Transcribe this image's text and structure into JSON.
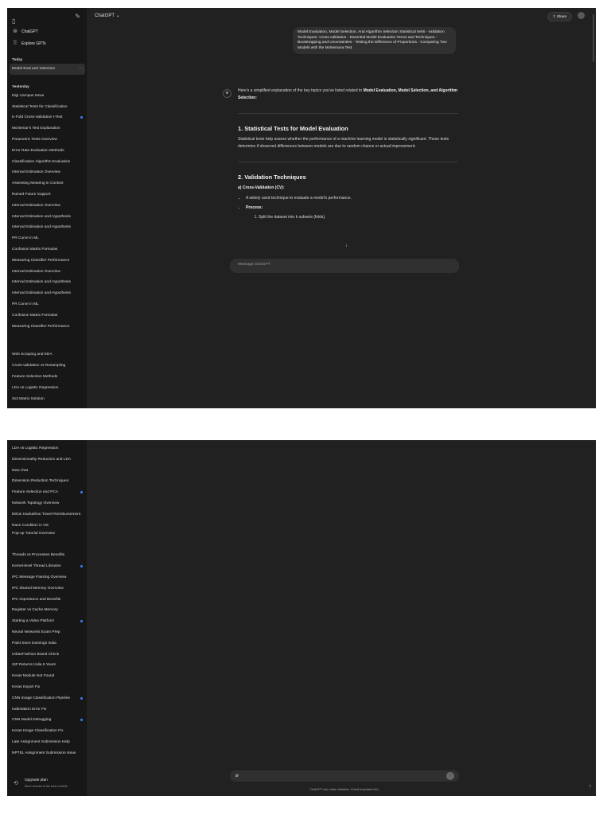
{
  "top": {
    "header": {
      "model": "ChatGPT ⌄",
      "share": "⇧ Share"
    },
    "sidebar": {
      "nav": [
        {
          "icon": "chatgpt-logo-icon",
          "label": "ChatGPT"
        },
        {
          "icon": "grid-icon",
          "label": "Explore GPTs"
        }
      ],
      "today_label": "Today",
      "today_items": [
        "Model Eval and Selection"
      ],
      "yesterday_label": "Yesterday",
      "yesterday_items": [
        "Digi Campus Issue",
        "Statistical Tests for Classification",
        "K-Fold Cross-Validation t-Test",
        "McNemar's Test Explanation",
        "Parametric Tests Overview",
        "Error Rate Evaluation Methods",
        "Classification Algorithm Evaluation",
        "Interval Estimation Overview",
        "Assessing Meaning in Context",
        "Ruined Future Support",
        "Interval Estimation Overview",
        "Interval Estimation and Hypothesis",
        "Interval Estimation and Hypothesis",
        "PR Curve in ML",
        "Confusion Matrix Formulas",
        "Measuring Classifier Performance",
        "Interval Estimation Overview",
        "Interval Estimation and Hypothesis",
        "Interval Estimation and Hypothesis",
        "PR Curve in ML",
        "Confusion Matrix Formulas",
        "Measuring Classifier Performance"
      ],
      "more_items": [
        "Web Scraping and EDA",
        "Cross-validation vs Resampling",
        "Feature Selection Methods",
        "LDA vs Logistic Regression",
        "3x3 Matrix Solution"
      ]
    },
    "user_message": "Model Evaluation, Model Selection, And Algorithm Selection Statistical tests - validation Techniques- Cross validation - Essential Model Evaluation Terms and Techniques - Bootstrapping and Uncertainties - Testing the Difference of Proportions - Comparing Two Models with the McNemara Test.",
    "answer": {
      "intro": "Here's a simplified explanation of the key topics you've listed related to",
      "intro_bold": "Model Evaluation, Model Selection, and Algorithm Selection:",
      "h1": "1. Statistical Tests for Model Evaluation",
      "p1": "Statistical tests help assess whether the performance of a machine learning model is statistically significant. These tests determine if observed differences between models are due to random chance or actual improvement.",
      "h2": "2. Validation Techniques",
      "sub": "a) Cross-Validation (CV):",
      "b1": "A widely used technique to evaluate a model's performance.",
      "b2": "Process:",
      "step1": "Split the dataset into k subsets (folds)."
    },
    "composer_placeholder": "Message ChatGPT"
  },
  "bottom": {
    "sidebar_items": [
      {
        "label": "LDA vs Logistic Regression",
        "dot": false
      },
      {
        "label": "Dimensionality Reduction and LDA",
        "dot": false
      },
      {
        "label": "New chat",
        "dot": false
      },
      {
        "label": "Dimension Reduction Techniques",
        "dot": false
      },
      {
        "label": "Feature Selection and PCA",
        "dot": true
      },
      {
        "label": "Network Topology Overview",
        "dot": false
      },
      {
        "label": "Ethos Hackathon Travel Reimbursement",
        "dot": false
      },
      {
        "label": "Race Condition in OS",
        "dot": false
      },
      {
        "label": "Pop-up Tutorial Overview",
        "dot": false
      },
      {
        "label": "",
        "dot": false
      },
      {
        "label": "Threads vs Processes Benefits",
        "dot": false
      },
      {
        "label": "Kernel-level Thread Libraries",
        "dot": true
      },
      {
        "label": "IPC Message Passing Overview",
        "dot": false
      },
      {
        "label": "IPC Shared Memory Overview",
        "dot": false
      },
      {
        "label": "IPC Importance and Benefits",
        "dot": false
      },
      {
        "label": "Register vs Cache Memory",
        "dot": false
      },
      {
        "label": "Starting a Video Platform",
        "dot": true
      },
      {
        "label": "Neural Networks Exam Prep",
        "dot": false
      },
      {
        "label": "Paint Store Earnings India",
        "dot": false
      },
      {
        "label": "UrbanFashion Brand Check",
        "dot": false
      },
      {
        "label": "SIP Returns India 5 Years",
        "dot": false
      },
      {
        "label": "Keras Module Not Found",
        "dot": false
      },
      {
        "label": "Keras Import Fix",
        "dot": false
      },
      {
        "label": "CNN Image Classification Pipeline",
        "dot": true
      },
      {
        "label": "Indentation Error Fix",
        "dot": false
      },
      {
        "label": "CNN Model Debugging",
        "dot": true
      },
      {
        "label": "Keras Image Classification Fix",
        "dot": false
      },
      {
        "label": "Late Assignment Submission Help",
        "dot": false
      },
      {
        "label": "NPTEL Assignment Submission Issue",
        "dot": false
      }
    ],
    "upgrade_title": "Upgrade plan",
    "upgrade_sub": "More access to the best models",
    "disclaimer": "ChatGPT can make mistakes. Check important info."
  }
}
